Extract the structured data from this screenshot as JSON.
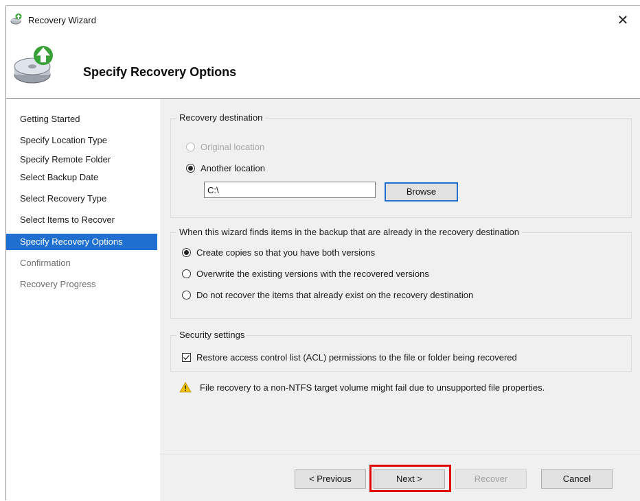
{
  "window": {
    "title": "Recovery Wizard",
    "close_glyph": "✕"
  },
  "header": {
    "title": "Specify Recovery Options"
  },
  "nav": {
    "items": [
      {
        "label": "Getting Started",
        "state": "normal"
      },
      {
        "label": "Specify Location Type",
        "state": "normal"
      },
      {
        "label": "Specify Remote Folder",
        "state": "normal"
      },
      {
        "label": "Select Backup Date",
        "state": "normal"
      },
      {
        "label": "Select Recovery Type",
        "state": "normal"
      },
      {
        "label": "Select Items to Recover",
        "state": "normal"
      },
      {
        "label": "Specify Recovery Options",
        "state": "active"
      },
      {
        "label": "Confirmation",
        "state": "disabled"
      },
      {
        "label": "Recovery Progress",
        "state": "disabled"
      }
    ]
  },
  "recovery_destination": {
    "title": "Recovery destination",
    "original_label": "Original location",
    "another_label": "Another location",
    "selected": "another",
    "path_value": "C:\\",
    "browse_label": "Browse"
  },
  "conflict": {
    "title": "When this wizard finds items in the backup that are already in the recovery destination",
    "options": [
      "Create copies so that you have both versions",
      "Overwrite the existing versions with the recovered versions",
      "Do not recover the items that already exist on the recovery destination"
    ],
    "selected_index": 0
  },
  "security": {
    "title": "Security settings",
    "acl_label": "Restore access control list (ACL) permissions to the file or folder being recovered",
    "acl_checked": true
  },
  "warning": {
    "text": "File recovery to a non-NTFS target volume might fail due to unsupported file properties."
  },
  "buttons": {
    "previous": "< Previous",
    "next": "Next >",
    "recover": "Recover",
    "cancel": "Cancel"
  },
  "colors": {
    "accent": "#1f6fd1",
    "highlight": "#e10000",
    "content_bg": "#f0f0f0",
    "warning": "#f2c200"
  }
}
